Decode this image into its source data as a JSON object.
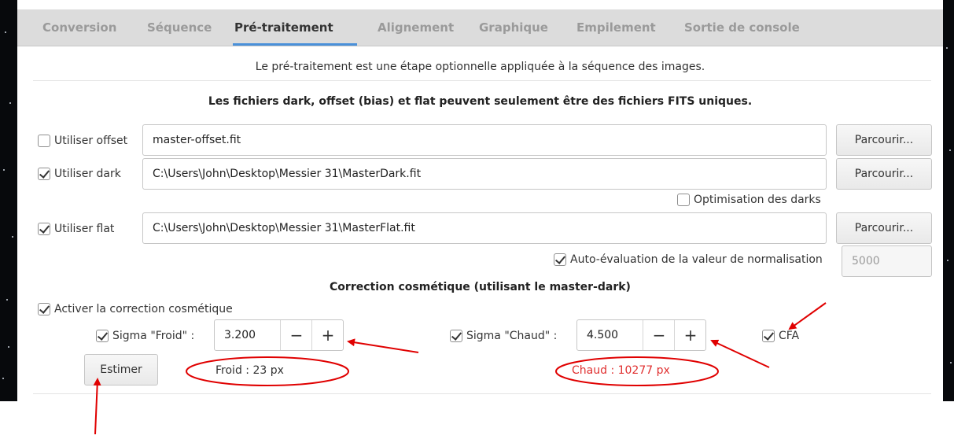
{
  "tabs": [
    "Conversion",
    "Séquence",
    "Pré-traitement",
    "Alignement",
    "Graphique",
    "Empilement",
    "Sortie de console"
  ],
  "active_tab": "Pré-traitement",
  "info_text": "Le pré-traitement est une étape optionnelle appliquée à la séquence des images.",
  "bold_note": "Les fichiers dark, offset (bias) et flat peuvent seulement être des fichiers FITS uniques.",
  "offset": {
    "label": "Utiliser offset",
    "checked": false,
    "path": "master-offset.fit",
    "browse": "Parcourir..."
  },
  "dark": {
    "label": "Utiliser dark",
    "checked": true,
    "path": "C:\\Users\\John\\Desktop\\Messier 31\\MasterDark.fit",
    "browse": "Parcourir..."
  },
  "dark_optim": {
    "label": "Optimisation des darks",
    "checked": false
  },
  "flat": {
    "label": "Utiliser flat",
    "checked": true,
    "path": "C:\\Users\\John\\Desktop\\Messier 31\\MasterFlat.fit",
    "browse": "Parcourir..."
  },
  "auto_norm": {
    "label": "Auto-évaluation de la valeur de normalisation",
    "checked": true,
    "value": "5000"
  },
  "cosmetic": {
    "title": "Correction cosmétique (utilisant le master-dark)",
    "enable_label": "Activer la correction cosmétique",
    "cold": {
      "label": "Sigma \"Froid\" :",
      "value": "3.200",
      "minus": "−",
      "plus": "+"
    },
    "hot": {
      "label": "Sigma \"Chaud\" :",
      "value": "4.500",
      "minus": "−",
      "plus": "+"
    },
    "cfa_label": "CFA",
    "estimate_button": "Estimer",
    "cold_result": "Froid : 23 px",
    "hot_result": "Chaud : 10277 px"
  },
  "colors": {
    "accent": "#4a90d9",
    "annotation": "#e00000",
    "hot_text": "#e03030"
  }
}
